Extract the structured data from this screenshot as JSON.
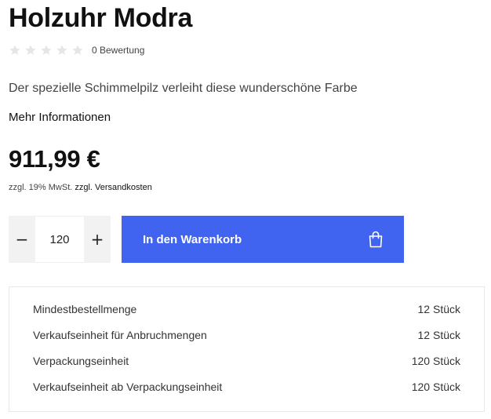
{
  "product": {
    "title": "Holzuhr Modra",
    "rating_text": "0 Bewertung",
    "stars": 5,
    "description": "Der spezielle Schimmelpilz verleiht diese wunderschöne Farbe",
    "more_info": "Mehr Informationen",
    "price": "911,99 €",
    "tax_note": "zzgl. 19% MwSt.",
    "shipping_link": "zzgl. Versandkosten"
  },
  "purchase": {
    "minus": "−",
    "plus": "+",
    "quantity": "120",
    "cart_label": "In den Warenkorb"
  },
  "info": {
    "rows": [
      {
        "label": "Mindestbestellmenge",
        "value": "12 Stück"
      },
      {
        "label": "Verkaufseinheit für Anbruchmengen",
        "value": "12 Stück"
      },
      {
        "label": "Verpackungseinheit",
        "value": "120 Stück"
      },
      {
        "label": "Verkaufseinheit ab Verpackungseinheit",
        "value": "120 Stück"
      }
    ]
  },
  "colors": {
    "accent": "#4164f0",
    "star_empty": "#e6e6e6"
  },
  "icons": {
    "star": "star-icon",
    "cart": "shopping-bag-icon"
  }
}
